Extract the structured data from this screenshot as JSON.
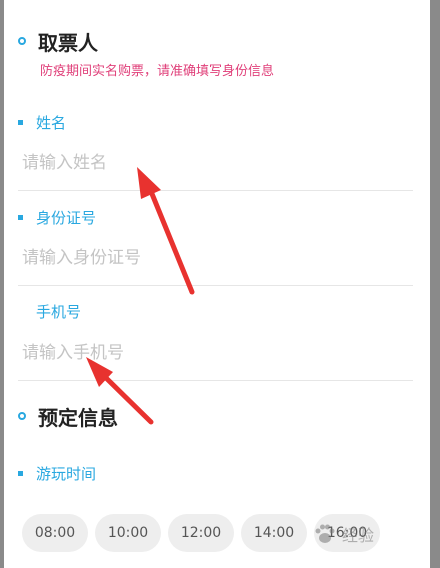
{
  "ticket_holder": {
    "title": "取票人",
    "notice": "防疫期间实名购票，请准确填写身份信息",
    "fields": [
      {
        "label": "姓名",
        "placeholder": "请输入姓名"
      },
      {
        "label": "身份证号",
        "placeholder": "请输入身份证号"
      },
      {
        "label": "手机号",
        "placeholder": "请输入手机号"
      }
    ]
  },
  "booking": {
    "title": "预定信息",
    "play_time_label": "游玩时间",
    "times": [
      "08:00",
      "10:00",
      "12:00",
      "14:00",
      "16:00"
    ]
  },
  "watermark": {
    "text": "经验"
  },
  "colors": {
    "accent": "#29a8e0",
    "notice": "#e0407a",
    "arrow": "#e8322f",
    "placeholder": "#c4c4c4"
  }
}
